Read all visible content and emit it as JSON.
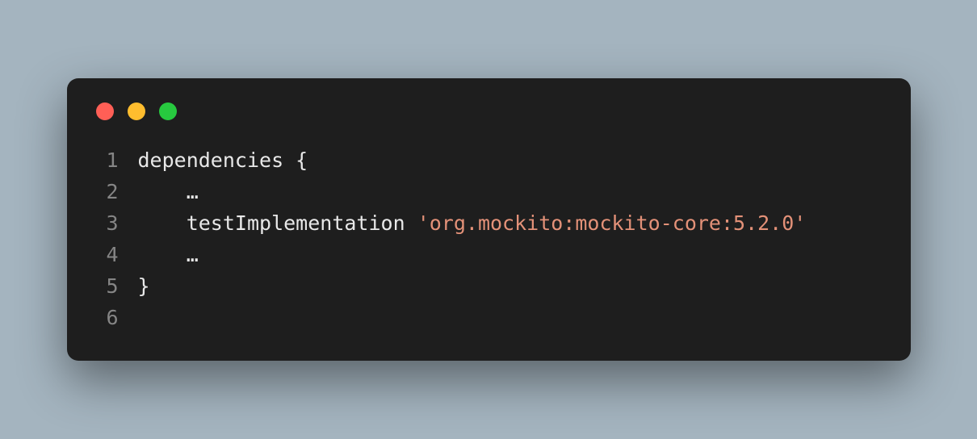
{
  "code": {
    "lines": [
      {
        "number": "1",
        "tokens": [
          {
            "kind": "plain",
            "text": "dependencies {"
          }
        ]
      },
      {
        "number": "2",
        "tokens": [
          {
            "kind": "plain",
            "text": "    …"
          }
        ]
      },
      {
        "number": "3",
        "tokens": [
          {
            "kind": "plain",
            "text": "    testImplementation "
          },
          {
            "kind": "string",
            "text": "'org.mockito:mockito-core:5.2.0'"
          }
        ]
      },
      {
        "number": "4",
        "tokens": [
          {
            "kind": "plain",
            "text": "    …"
          }
        ]
      },
      {
        "number": "5",
        "tokens": [
          {
            "kind": "plain",
            "text": "}"
          }
        ]
      },
      {
        "number": "6",
        "tokens": []
      }
    ]
  }
}
